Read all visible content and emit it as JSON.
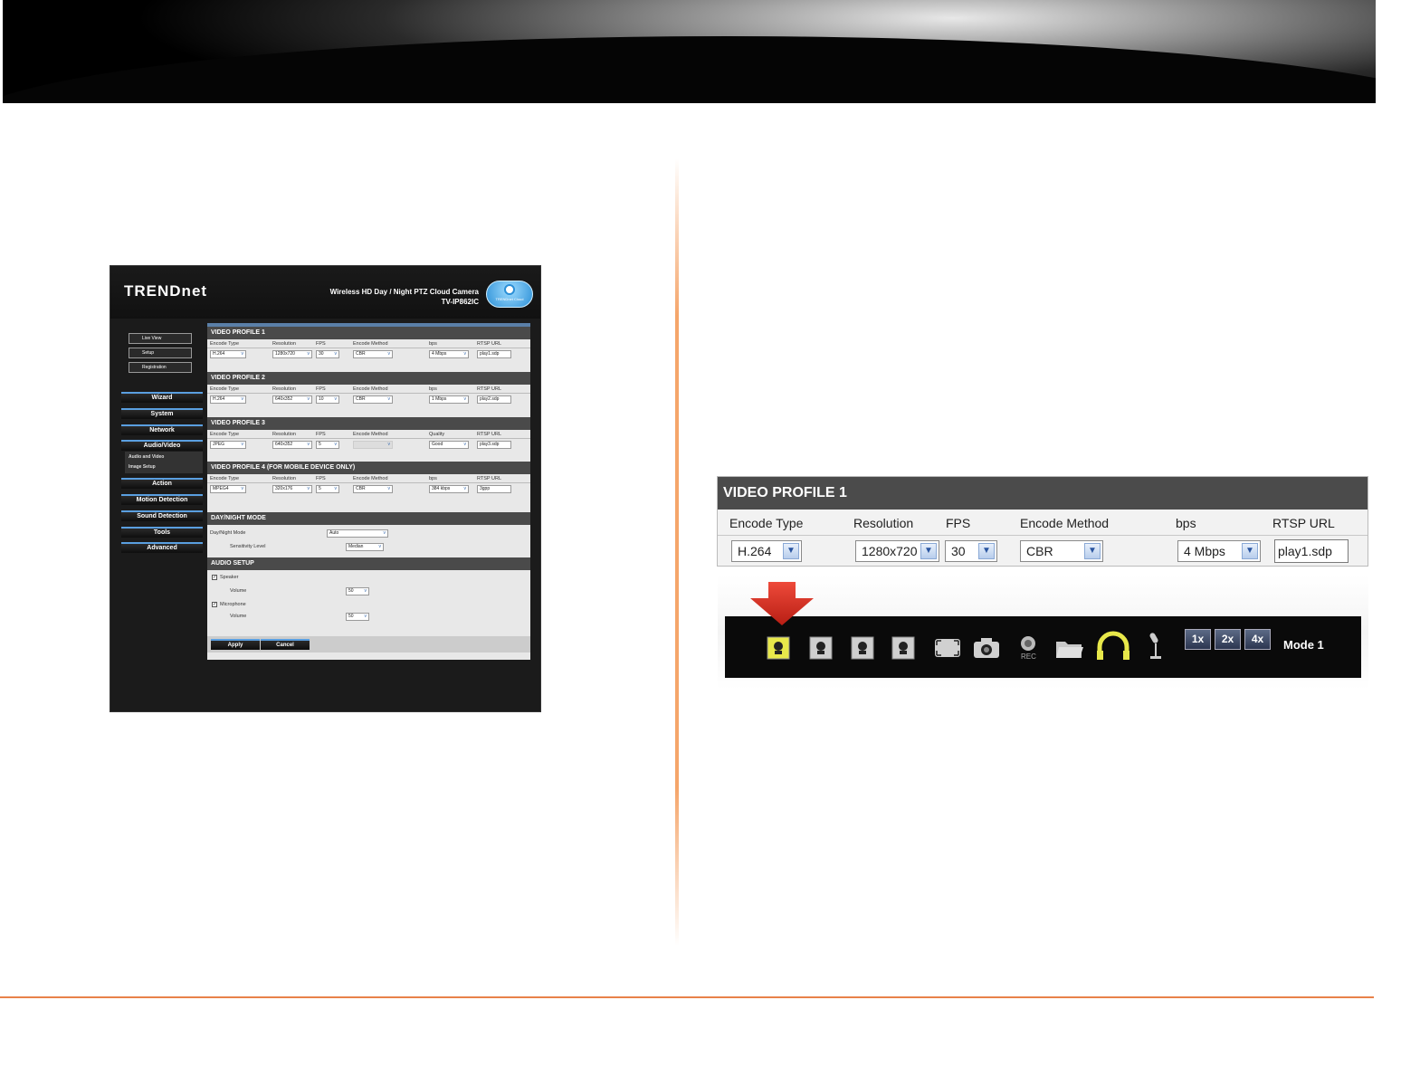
{
  "camera_ui": {
    "logo": "TRENDnet",
    "title_line1": "Wireless HD Day / Night PTZ Cloud Camera",
    "title_line2": "TV-IP862IC",
    "cloud_text": "TRENDnet Cloud",
    "nav_top": [
      "Live View",
      "Setup",
      "Registration"
    ],
    "nav_main": [
      "Wizard",
      "System",
      "Network",
      "Audio/Video",
      "Action",
      "Motion Detection",
      "Sound Detection",
      "Tools",
      "Advanced"
    ],
    "nav_sub": [
      "Audio and Video",
      "Image Setup"
    ],
    "profiles": [
      {
        "title": "VIDEO PROFILE 1",
        "cols": [
          "Encode Type",
          "Resolution",
          "FPS",
          "Encode Method",
          "bps",
          "RTSP URL"
        ],
        "vals": [
          "H.264",
          "1280x720",
          "30",
          "CBR",
          "4 Mbps",
          "play1.sdp"
        ]
      },
      {
        "title": "VIDEO PROFILE 2",
        "cols": [
          "Encode Type",
          "Resolution",
          "FPS",
          "Encode Method",
          "bps",
          "RTSP URL"
        ],
        "vals": [
          "H.264",
          "640x352",
          "10",
          "CBR",
          "1 Mbps",
          "play2.sdp"
        ]
      },
      {
        "title": "VIDEO PROFILE 3",
        "cols": [
          "Encode Type",
          "Resolution",
          "FPS",
          "Encode Method",
          "Quality",
          "RTSP URL"
        ],
        "vals": [
          "JPEG",
          "640x352",
          "5",
          "",
          "Good",
          "play3.sdp"
        ]
      },
      {
        "title": "VIDEO PROFILE 4 (FOR MOBILE DEVICE ONLY)",
        "cols": [
          "Encode Type",
          "Resolution",
          "FPS",
          "Encode Method",
          "bps",
          "RTSP URL"
        ],
        "vals": [
          "MPEG4",
          "320x176",
          "5",
          "CBR",
          "384 kbps",
          "3gpp"
        ]
      }
    ],
    "day_night": {
      "title": "DAY/NIGHT MODE",
      "mode_label": "Day/Night Mode",
      "mode_value": "Auto",
      "sens_label": "Sensitivity Level",
      "sens_value": "Median"
    },
    "audio": {
      "title": "AUDIO SETUP",
      "speaker": "Speaker",
      "mic": "Microphone",
      "volume_label": "Volume",
      "speaker_volume": "50",
      "mic_volume": "50"
    },
    "buttons": {
      "apply": "Apply",
      "cancel": "Cancel"
    }
  },
  "video_profile_zoom": {
    "title": "VIDEO PROFILE 1",
    "columns": [
      "Encode Type",
      "Resolution",
      "FPS",
      "Encode Method",
      "bps",
      "RTSP URL"
    ],
    "encode_type": "H.264",
    "resolution": "1280x720",
    "fps": "30",
    "encode_method": "CBR",
    "bps": "4 Mbps",
    "rtsp_url": "play1.sdp"
  },
  "toolbar": {
    "rec_label": "REC",
    "zoom": [
      "1x",
      "2x",
      "4x"
    ],
    "mode": "Mode 1",
    "accent": "#e8e84a",
    "arrow_color": "#d92b20"
  },
  "colors": {
    "divider": "#f5a56a",
    "footer_line": "#e8824a",
    "header_gray": "#4b4b4b"
  }
}
